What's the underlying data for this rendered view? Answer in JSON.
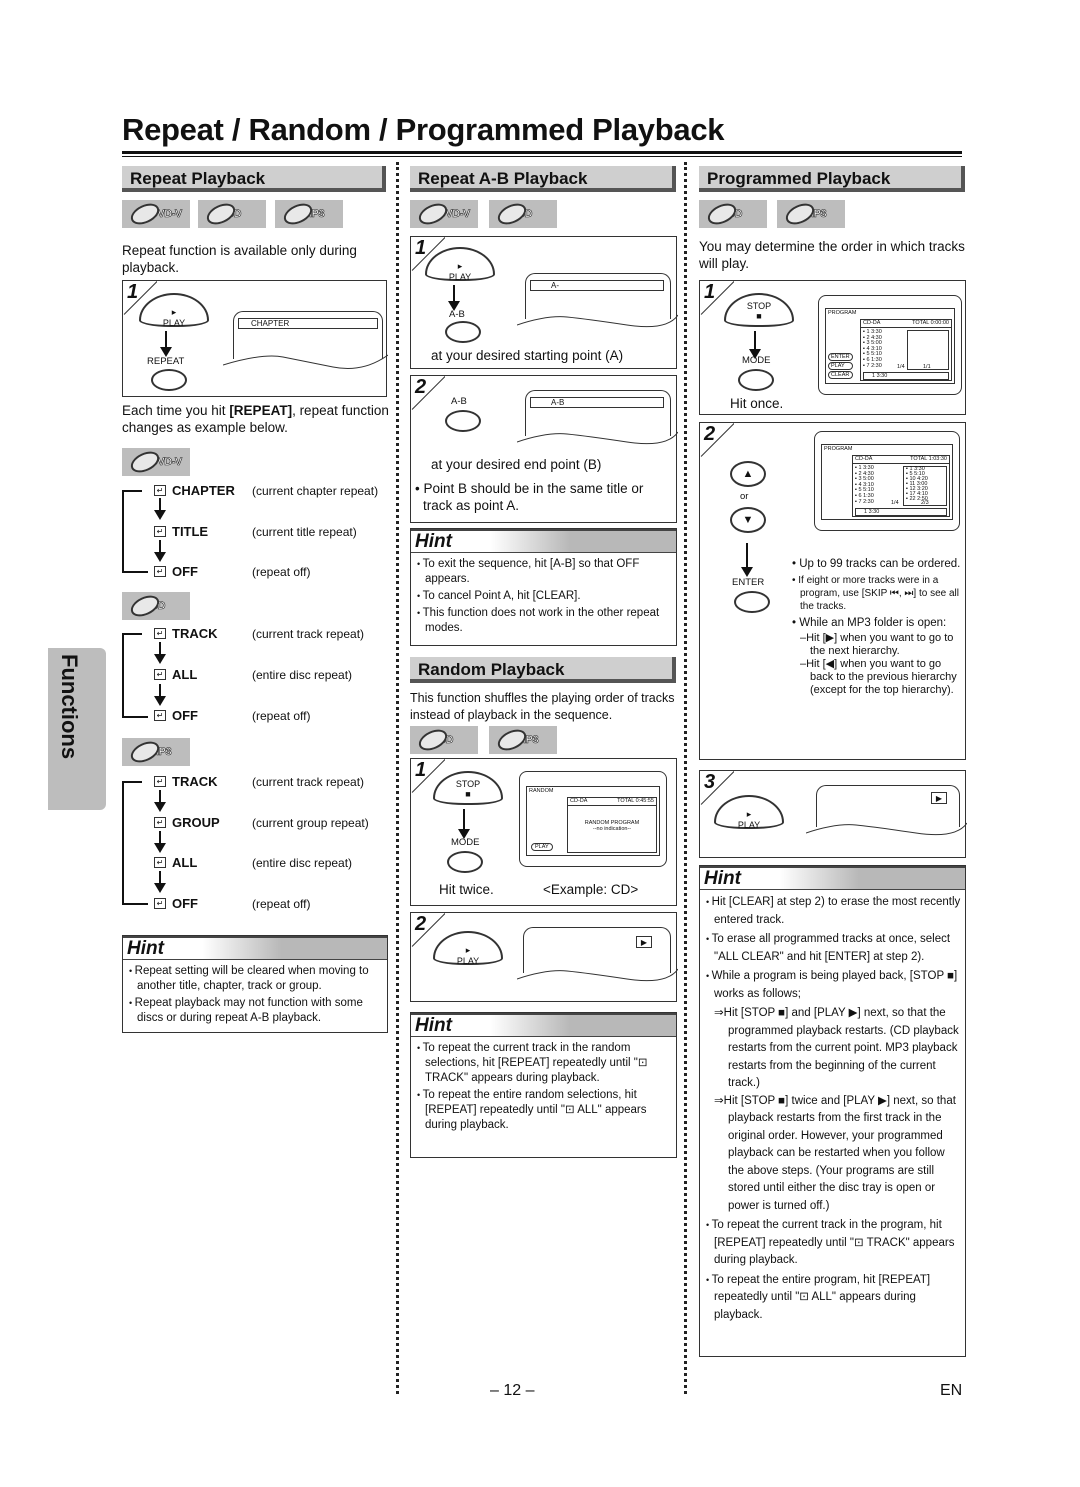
{
  "page": {
    "title": "Repeat / Random / Programmed Playback",
    "side_tab": "Functions",
    "page_number": "– 12 –",
    "language": "EN"
  },
  "repeat_playback": {
    "heading": "Repeat Playback",
    "badges": [
      "DVD-V",
      "CD",
      "MP3"
    ],
    "intro": "Repeat function is available only during playback.",
    "step1": {
      "num": "1",
      "btn_play": "PLAY",
      "btn_repeat": "REPEAT",
      "screen_text": "CHAPTER"
    },
    "each_time": "Each time you hit [REPEAT], repeat function changes as example below.",
    "dvd": {
      "badge": "DVD-V",
      "modes": [
        {
          "mode": "CHAPTER",
          "desc": "(current chapter repeat)"
        },
        {
          "mode": "TITLE",
          "desc": "(current title repeat)"
        },
        {
          "mode": "OFF",
          "desc": "(repeat off)"
        }
      ]
    },
    "cd": {
      "badge": "CD",
      "modes": [
        {
          "mode": "TRACK",
          "desc": "(current track repeat)"
        },
        {
          "mode": "ALL",
          "desc": "(entire disc repeat)"
        },
        {
          "mode": "OFF",
          "desc": "(repeat off)"
        }
      ]
    },
    "mp3": {
      "badge": "MP3",
      "modes": [
        {
          "mode": "TRACK",
          "desc": "(current track repeat)"
        },
        {
          "mode": "GROUP",
          "desc": "(current group repeat)"
        },
        {
          "mode": "ALL",
          "desc": "(entire disc repeat)"
        },
        {
          "mode": "OFF",
          "desc": "(repeat off)"
        }
      ]
    },
    "hint": {
      "title": "Hint",
      "items": [
        "Repeat setting will be cleared when moving to another title, chapter, track or group.",
        "Repeat playback may not function with some discs or during repeat A-B playback."
      ]
    }
  },
  "ab_playback": {
    "heading": "Repeat A-B Playback",
    "badges": [
      "DVD-V",
      "CD"
    ],
    "step1": {
      "num": "1",
      "btn_play": "PLAY",
      "btn_ab": "A-B",
      "screen_text": "A-",
      "caption": "at your desired starting point (A)"
    },
    "step2": {
      "num": "2",
      "btn_ab": "A-B",
      "screen_text": "A-B",
      "caption": "at your desired end point (B)",
      "note": "Point B should be in the same title or track as point A."
    },
    "hint": {
      "title": "Hint",
      "items": [
        "To exit the sequence, hit [A-B] so that OFF appears.",
        "To cancel Point A, hit [CLEAR].",
        "This function does not work in the other repeat modes."
      ]
    }
  },
  "random_playback": {
    "heading": "Random Playback",
    "intro": "This function shuffles the playing order of tracks instead of playback in the sequence.",
    "badges": [
      "CD",
      "MP3"
    ],
    "step1": {
      "num": "1",
      "btn_stop": "STOP",
      "btn_mode": "MODE",
      "caption_left": "Hit twice.",
      "caption_right": "<Example: CD>",
      "screen": {
        "title": "RANDOM",
        "source": "CD-DA",
        "total": "TOTAL 0:45:55",
        "line1": "RANDOM PROGRAM",
        "line2": "--no indication--",
        "btn": "PLAY"
      }
    },
    "step2": {
      "num": "2",
      "btn_play": "PLAY",
      "indicator": "▶"
    },
    "hint": {
      "title": "Hint",
      "items": [
        "To repeat the current track in the random selections, hit [REPEAT] repeatedly until \"⊡ TRACK\" appears during playback.",
        "To repeat the entire random selections, hit [REPEAT] repeatedly until \"⊡ ALL\" appears during playback."
      ]
    }
  },
  "programmed_playback": {
    "heading": "Programmed Playback",
    "badges": [
      "CD",
      "MP3"
    ],
    "intro": "You may determine the order in which tracks will play.",
    "step1": {
      "num": "1",
      "btn_stop": "STOP",
      "btn_mode": "MODE",
      "caption": "Hit once.",
      "screen": {
        "title": "PROGRAM",
        "source": "CD-DA",
        "total": "TOTAL 0:00:00",
        "tracks": [
          "1  3:30",
          "2  4:30",
          "3  5:00",
          "4  3:10",
          "5  5:10",
          "6  1:30",
          "7  2:30"
        ],
        "page_left": "1/4",
        "page_right": "1/1",
        "footer": "1  3:30",
        "buttons": [
          "ENTER",
          "PLAY",
          "CLEAR"
        ]
      }
    },
    "step2": {
      "num": "2",
      "or": "or",
      "btn_enter": "ENTER",
      "screen": {
        "title": "PROGRAM",
        "source": "CD-DA",
        "total": "TOTAL 1:03:30",
        "tracks": [
          "1  3:30",
          "2  4:30",
          "3  5:00",
          "4  3:10",
          "5  5:10",
          "6  1:30",
          "7  2:30"
        ],
        "program": [
          "1  3:30",
          "5  5:10",
          "10  4:20",
          "11  3:00",
          "12  3:20",
          "17  4:10",
          "22  2:50"
        ],
        "page_left": "1/4",
        "page_right": "2/3",
        "footer": "1  3:30"
      },
      "notes": [
        {
          "text": "Up to 99 tracks can be ordered.",
          "small": false
        },
        {
          "text": "If eight or more tracks were in a program, use [SKIP ⏮, ⏭] to see all the tracks.",
          "small": true
        },
        {
          "text": "While an MP3 folder is open:",
          "small": false
        }
      ],
      "subnotes": [
        "–Hit [▶] when you want to go to the next hierarchy.",
        "–Hit [◀] when you want to go back to the previous hierarchy (except for the top hierarchy)."
      ]
    },
    "step3": {
      "num": "3",
      "btn_play": "PLAY",
      "indicator": "▶"
    },
    "hint": {
      "title": "Hint",
      "items": [
        "Hit [CLEAR] at step 2) to erase the most recently entered track.",
        "To erase all programmed tracks at once, select \"ALL CLEAR\" and hit [ENTER] at step 2).",
        "While a program is being played back, [STOP ■] works as follows;"
      ],
      "sub_items": [
        "⇒Hit [STOP ■] and [PLAY ▶] next, so that the programmed playback restarts. (CD playback restarts from the current point. MP3 playback restarts from the beginning of the current track.)",
        "⇒Hit [STOP ■] twice and [PLAY ▶] next, so that playback restarts from the first track in the original order. However, your programmed playback can be restarted when you follow the above steps. (Your programs are still stored until either the disc tray is open or power is turned off.)"
      ],
      "items_after": [
        "To repeat the current track in the program, hit [REPEAT] repeatedly until \"⊡ TRACK\" appears during playback.",
        "To repeat the entire program, hit [REPEAT] repeatedly until \"⊡ ALL\" appears during playback."
      ]
    }
  }
}
